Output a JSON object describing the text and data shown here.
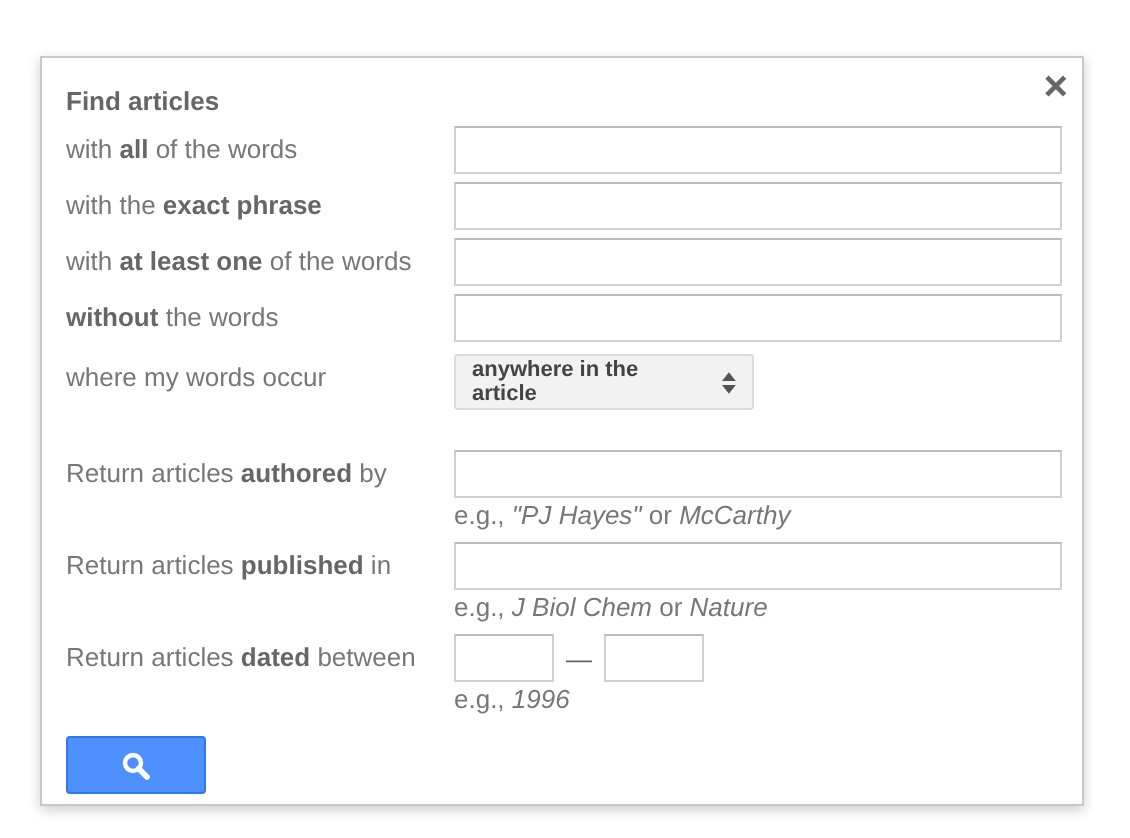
{
  "dialog": {
    "title": "Find articles",
    "close": "×",
    "rows": [
      {
        "kind": "field",
        "label": "with **all** of the words"
      },
      {
        "kind": "field",
        "label": "with the **exact phrase**"
      },
      {
        "kind": "field",
        "label": "with **at least one** of the words"
      },
      {
        "kind": "field",
        "label": "**without** the words"
      },
      {
        "kind": "select",
        "label": "where my words occur",
        "value": "anywhere in the article"
      },
      {
        "kind": "spacer"
      },
      {
        "kind": "field",
        "label": "Return articles **authored** by",
        "hint": "e.g., *\"PJ Hayes\"* or *McCarthy*"
      },
      {
        "kind": "field",
        "label": "Return articles **published** in",
        "hint": "e.g., *J Biol Chem* or *Nature*"
      },
      {
        "kind": "range",
        "label": "Return articles **dated** between",
        "separator": "—",
        "hint": "e.g., *1996*"
      }
    ]
  }
}
